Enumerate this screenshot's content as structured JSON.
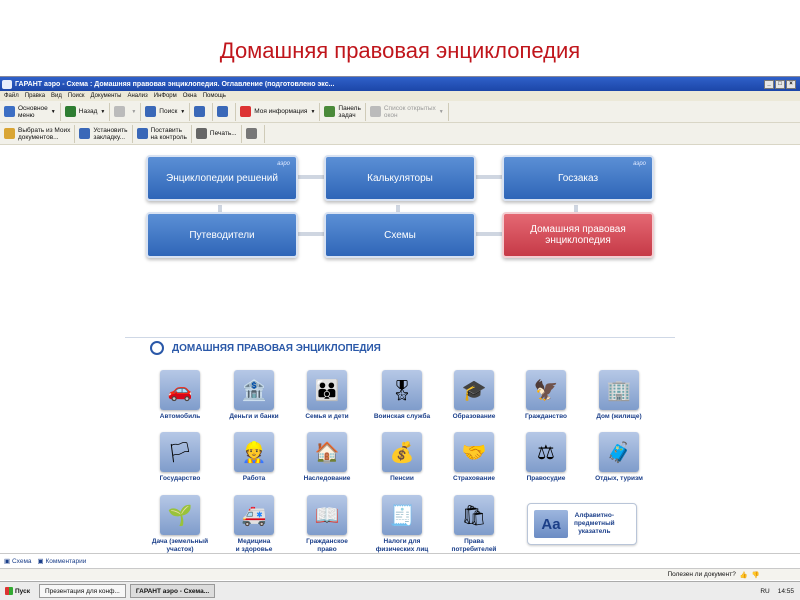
{
  "slide": {
    "title": "Домашняя правовая энциклопедия"
  },
  "window": {
    "title": "ГАРАНТ аэро - Схема : Домашняя правовая энциклопедия. Оглавление (подготовлено экс...",
    "menu": [
      "Файл",
      "Правка",
      "Вид",
      "Поиск",
      "Документы",
      "Анализ",
      "ИнФорм",
      "Окна",
      "Помощь"
    ]
  },
  "toolbar": {
    "row1": [
      {
        "label": "Основное\nменю",
        "icon": "home-icon",
        "caret": true,
        "disabled": false
      },
      {
        "label": "Назад",
        "icon": "back-icon",
        "caret": true,
        "disabled": false
      },
      {
        "label": "",
        "icon": "forward-icon",
        "caret": true,
        "disabled": true
      },
      {
        "label": "Поиск",
        "icon": "search-icon",
        "caret": true,
        "disabled": false
      },
      {
        "label": "",
        "icon": "font-increase-icon",
        "caret": false,
        "disabled": false
      },
      {
        "label": "",
        "icon": "font-decrease-icon",
        "caret": false,
        "disabled": false
      },
      {
        "label": "Моя информация",
        "icon": "heart-icon",
        "caret": true,
        "disabled": false
      },
      {
        "label": "Панель\nзадач",
        "icon": "tasks-icon",
        "caret": false,
        "disabled": false
      },
      {
        "label": "Список открытых\nокон",
        "icon": "windows-icon",
        "caret": true,
        "disabled": true
      }
    ],
    "row2": [
      {
        "label": "Выбрать из Моих\nдокументов...",
        "icon": "folder-icon",
        "caret": false,
        "disabled": false
      },
      {
        "label": "Установить\nзакладку...",
        "icon": "bookmark-icon",
        "caret": false,
        "disabled": false
      },
      {
        "label": "Поставить\nна контроль",
        "icon": "control-icon",
        "caret": false,
        "disabled": false
      },
      {
        "label": "Печать...",
        "icon": "print-icon",
        "caret": false,
        "disabled": false
      },
      {
        "label": "",
        "icon": "export-icon",
        "caret": false,
        "disabled": false
      }
    ]
  },
  "scheme": {
    "row1": [
      {
        "label": "Энциклопедии решений",
        "aero": "аэро",
        "color": "#3f78c6"
      },
      {
        "label": "Калькуляторы",
        "aero": "",
        "color": "#3f78c6"
      },
      {
        "label": "Госзаказ",
        "aero": "аэро",
        "color": "#3f78c6"
      }
    ],
    "row2": [
      {
        "label": "Путеводители",
        "aero": "",
        "color": "#3f78c6"
      },
      {
        "label": "Схемы",
        "aero": "",
        "color": "#3f78c6"
      },
      {
        "label": "Домашняя правовая\nэнциклопедия",
        "aero": "",
        "color": "#d24b57"
      }
    ]
  },
  "section": {
    "title": "ДОМАШНЯЯ ПРАВОВАЯ ЭНЦИКЛОПЕДИЯ",
    "categories": [
      {
        "label": "Автомобиль",
        "icon": "car-icon",
        "glyph": "🚗"
      },
      {
        "label": "Деньги и банки",
        "icon": "safe-icon",
        "glyph": "🏦"
      },
      {
        "label": "Семья и дети",
        "icon": "family-icon",
        "glyph": "👪"
      },
      {
        "label": "Воинская служба",
        "icon": "rifle-icon",
        "glyph": "🎖"
      },
      {
        "label": "Образование",
        "icon": "graduation-cap-icon",
        "glyph": "🎓"
      },
      {
        "label": "Гражданство",
        "icon": "coat-of-arms-icon",
        "glyph": "🦅"
      },
      {
        "label": "Дом (жилище)",
        "icon": "building-icon",
        "glyph": "🏢"
      },
      {
        "label": "Государство",
        "icon": "flag-icon",
        "glyph": "🏳"
      },
      {
        "label": "Работа",
        "icon": "worker-icon",
        "glyph": "👷"
      },
      {
        "label": "Наследование",
        "icon": "house-icon",
        "glyph": "🏠"
      },
      {
        "label": "Пенсии",
        "icon": "pension-icon",
        "glyph": "💰"
      },
      {
        "label": "Страхование",
        "icon": "handshake-icon",
        "glyph": "🤝"
      },
      {
        "label": "Правосудие",
        "icon": "gavel-icon",
        "glyph": "⚖"
      },
      {
        "label": "Отдых, туризм",
        "icon": "suitcase-icon",
        "glyph": "🧳"
      },
      {
        "label": "Дача (земельный\nучасток)",
        "icon": "wheelbarrow-icon",
        "glyph": "🌱"
      },
      {
        "label": "Медицина\nи здоровье",
        "icon": "ambulance-icon",
        "glyph": "🚑"
      },
      {
        "label": "Гражданское\nправо",
        "icon": "book-icon",
        "glyph": "📖"
      },
      {
        "label": "Налоги для\nфизических лиц",
        "icon": "taxpayer-icon",
        "glyph": "🧾"
      },
      {
        "label": "Права\nпотребителей",
        "icon": "shopping-bag-icon",
        "glyph": "🛍"
      }
    ],
    "alpha_index": {
      "glyph": "Aa",
      "label": "Алфавитно-\nпредметный\nуказатель"
    }
  },
  "bottom_tabs": [
    "Схема",
    "Комментарии"
  ],
  "status": {
    "text": "Полезен ли документ?"
  },
  "taskbar": {
    "start": "Пуск",
    "tasks": [
      {
        "label": "Презентация для конф...",
        "active": false
      },
      {
        "label": "ГАРАНТ аэро - Схема...",
        "active": true
      }
    ],
    "lang": "RU",
    "clock": "14:55"
  }
}
